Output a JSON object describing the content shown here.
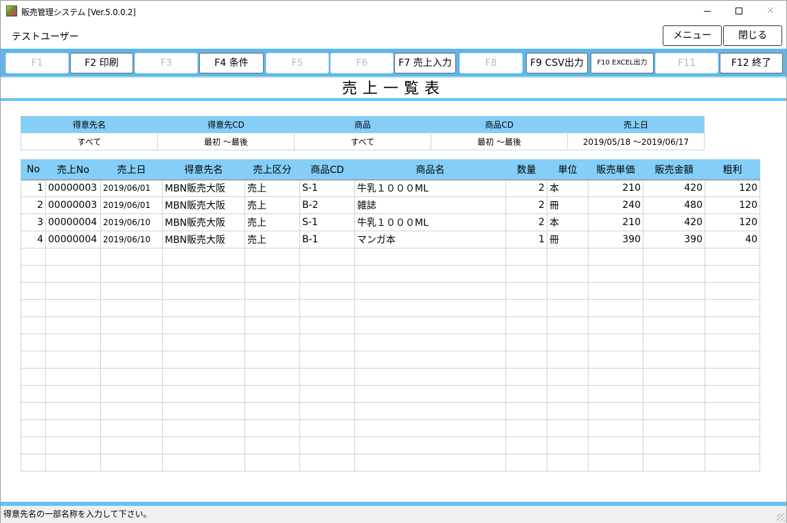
{
  "window": {
    "title": "販売管理システム [Ver.5.0.0.2]"
  },
  "header": {
    "user": "テストユーザー",
    "menu_label": "メニュー",
    "close_label": "閉じる"
  },
  "fkeys": [
    {
      "label": "F1",
      "enabled": false
    },
    {
      "label": "F2 印刷",
      "enabled": true
    },
    {
      "label": "F3",
      "enabled": false
    },
    {
      "label": "F4 条件",
      "enabled": true
    },
    {
      "label": "F5",
      "enabled": false
    },
    {
      "label": "F6",
      "enabled": false
    },
    {
      "label": "F7 売上入力",
      "enabled": true
    },
    {
      "label": "F8",
      "enabled": false
    },
    {
      "label": "F9 CSV出力",
      "enabled": true
    },
    {
      "label": "F10 EXCEL出力",
      "enabled": true
    },
    {
      "label": "F11",
      "enabled": false
    },
    {
      "label": "F12 終了",
      "enabled": true
    }
  ],
  "page_title": "売上一覧表",
  "conditions": {
    "headers": [
      "得意先名",
      "得意先CD",
      "商品",
      "商品CD",
      "売上日"
    ],
    "values": [
      "すべて",
      "最初 ～最後",
      "すべて",
      "最初 ～最後",
      "2019/05/18 ～2019/06/17"
    ]
  },
  "grid": {
    "headers": [
      "No",
      "売上No",
      "売上日",
      "得意先名",
      "売上区分",
      "商品CD",
      "商品名",
      "数量",
      "単位",
      "販売単価",
      "販売金額",
      "粗利"
    ],
    "rows": [
      [
        "1",
        "00000003",
        "2019/06/01",
        "MBN販売大阪",
        "売上",
        "S-1",
        "牛乳１０００ML",
        "2",
        "本",
        "210",
        "420",
        "120"
      ],
      [
        "2",
        "00000003",
        "2019/06/01",
        "MBN販売大阪",
        "売上",
        "B-2",
        "雑誌",
        "2",
        "冊",
        "240",
        "480",
        "120"
      ],
      [
        "3",
        "00000004",
        "2019/06/10",
        "MBN販売大阪",
        "売上",
        "S-1",
        "牛乳１０００ML",
        "2",
        "本",
        "210",
        "420",
        "120"
      ],
      [
        "4",
        "00000004",
        "2019/06/10",
        "MBN販売大阪",
        "売上",
        "B-1",
        "マンガ本",
        "1",
        "冊",
        "390",
        "390",
        "40"
      ]
    ],
    "empty_rows": 13
  },
  "status": {
    "message": "得意先名の一部名称を入力して下さい。"
  },
  "icons": {
    "app": "app-icon",
    "minimize": "minimize-icon",
    "maximize": "maximize-icon",
    "close": "close-icon"
  }
}
